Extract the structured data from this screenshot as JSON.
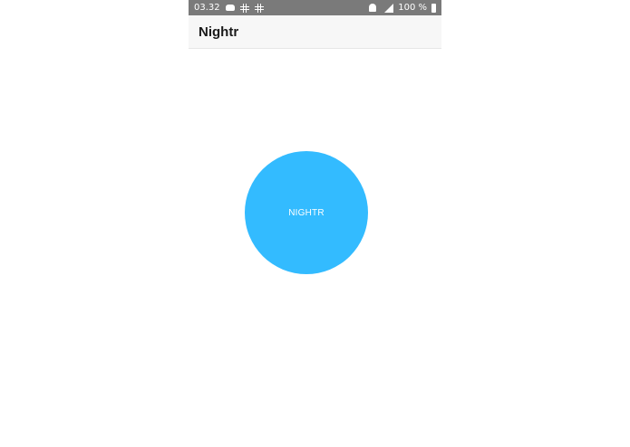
{
  "status_bar": {
    "time": "03.32",
    "battery_text": "100 %",
    "left_icons": [
      "car-icon",
      "slack-icon",
      "slack-icon"
    ],
    "right_icons": [
      "bell-off-icon",
      "signal-icon",
      "battery-icon"
    ]
  },
  "app_bar": {
    "title": "Nightr"
  },
  "main": {
    "button_label": "NIGHTR",
    "button_color": "#33bbff"
  },
  "colors": {
    "status_bar_bg": "#7a7a7a",
    "app_bar_bg": "#f7f7f7",
    "background": "#ffffff"
  }
}
